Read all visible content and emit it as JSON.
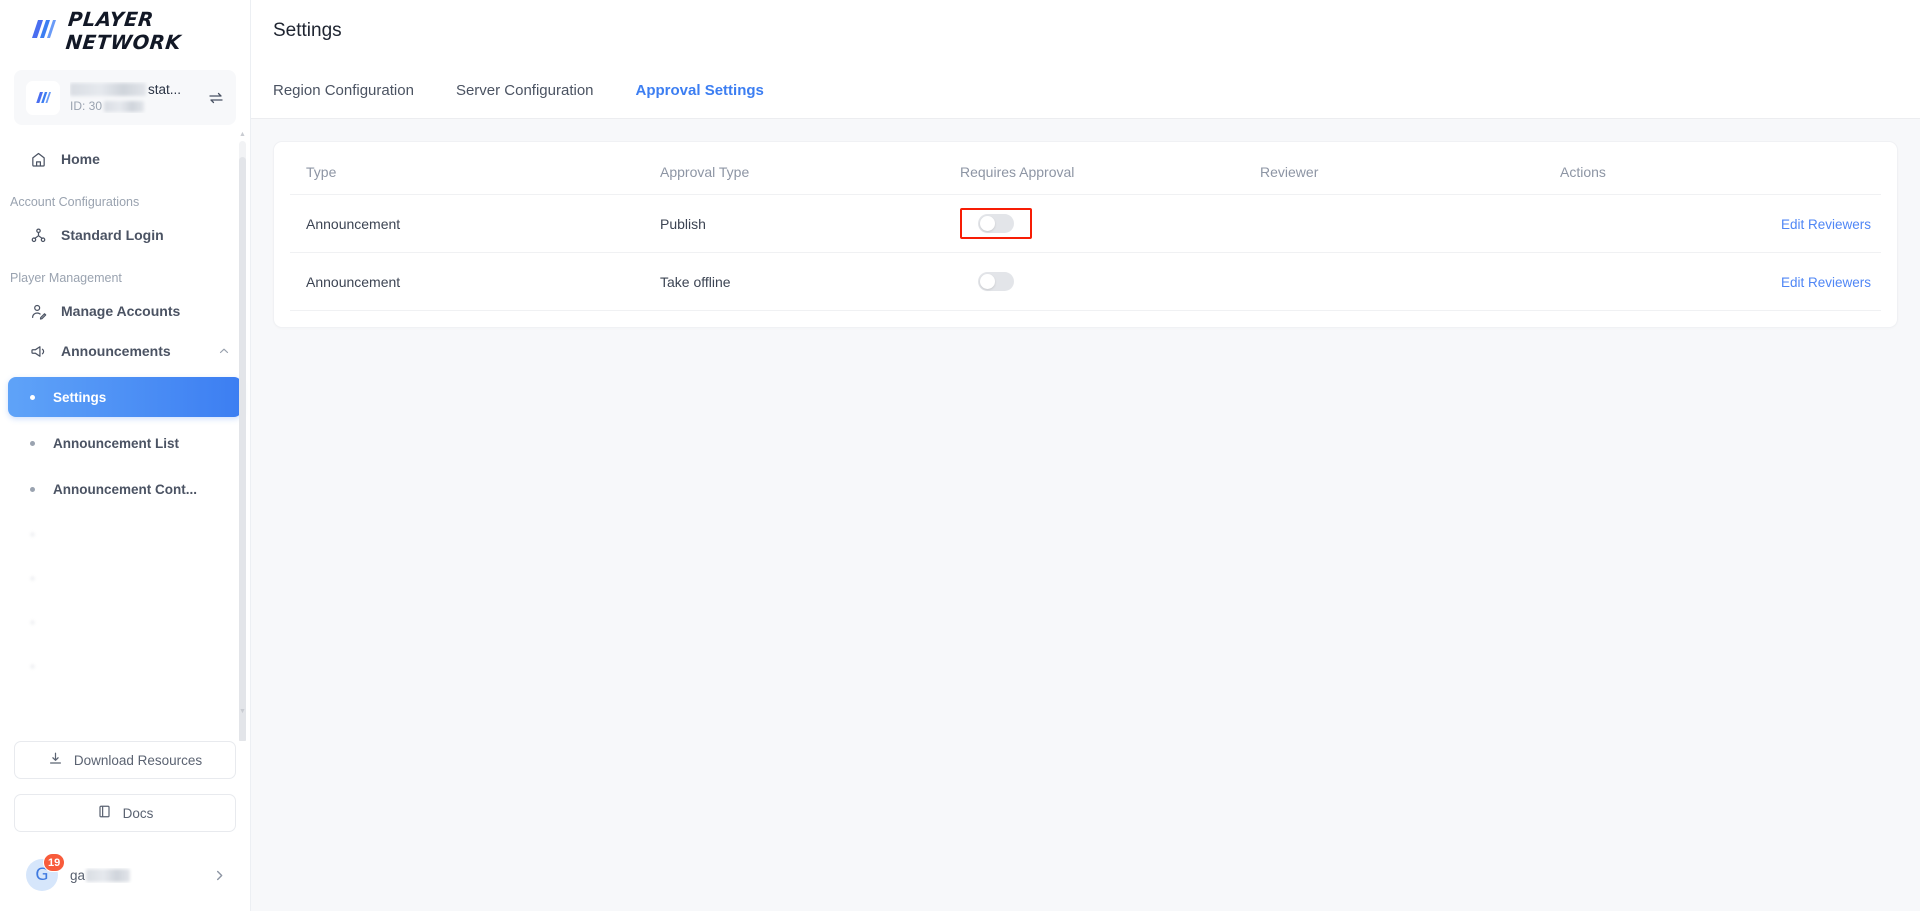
{
  "brand": {
    "name": "PLAYER NETWORK",
    "logo_icon": "player-network-logo-icon"
  },
  "account_card": {
    "name_suffix": "stat...",
    "id_label": "ID: 30",
    "swap_icon": "swap-horizontal-icon",
    "logo_icon": "account-logo-icon"
  },
  "sidebar": {
    "home": {
      "label": "Home",
      "icon": "home-icon"
    },
    "groups": [
      {
        "label": "Account Configurations"
      },
      {
        "label": "Player Management"
      }
    ],
    "items": [
      {
        "label": "Standard Login",
        "icon": "sitemap-icon"
      },
      {
        "label": "Manage Accounts",
        "icon": "user-edit-icon"
      },
      {
        "label": "Announcements",
        "icon": "megaphone-icon",
        "caret": "chevron-up-icon"
      }
    ],
    "sub_items": [
      {
        "label": "Settings",
        "active": true
      },
      {
        "label": "Announcement List",
        "active": false
      },
      {
        "label": "Announcement Cont...",
        "active": false
      }
    ],
    "footer": {
      "download": {
        "label": "Download Resources",
        "icon": "download-icon"
      },
      "docs": {
        "label": "Docs",
        "icon": "book-icon"
      }
    },
    "user": {
      "initial": "G",
      "badge_count": "19",
      "name_prefix": "ga",
      "chevron_icon": "chevron-right-icon"
    }
  },
  "header": {
    "title": "Settings"
  },
  "tabs": [
    {
      "label": "Region Configuration",
      "active": false
    },
    {
      "label": "Server Configuration",
      "active": false
    },
    {
      "label": "Approval Settings",
      "active": true
    }
  ],
  "table": {
    "columns": [
      "Type",
      "Approval Type",
      "Requires Approval",
      "Reviewer",
      "Actions"
    ],
    "rows": [
      {
        "type": "Announcement",
        "approval_type": "Publish",
        "requires_approval": false,
        "reviewer": "",
        "action_label": "Edit Reviewers",
        "highlighted": true
      },
      {
        "type": "Announcement",
        "approval_type": "Take offline",
        "requires_approval": false,
        "reviewer": "",
        "action_label": "Edit Reviewers",
        "highlighted": false
      }
    ]
  },
  "colors": {
    "accent": "#3c7ef2",
    "link": "#4f86f5",
    "highlight": "#f71d05",
    "badge": "#f85b3b",
    "page_bg": "#f7f8fa"
  }
}
